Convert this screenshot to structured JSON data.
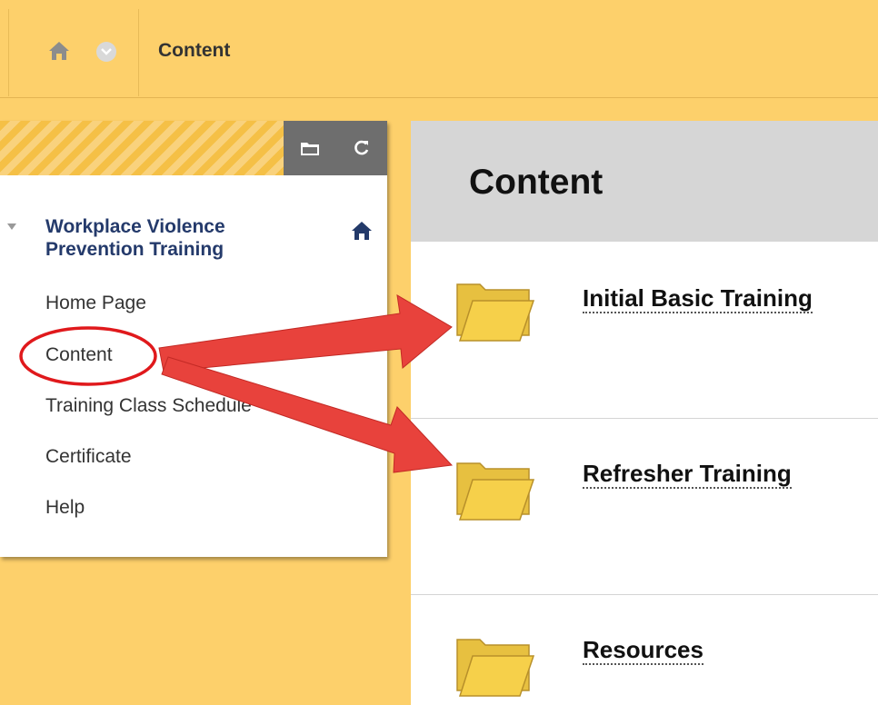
{
  "breadcrumb": {
    "current": "Content"
  },
  "course_menu": {
    "course_title": "Workplace Violence Prevention Training",
    "items": [
      {
        "label": "Home Page"
      },
      {
        "label": "Content"
      },
      {
        "label": "Training Class Schedule"
      },
      {
        "label": "Certificate"
      },
      {
        "label": "Help"
      }
    ]
  },
  "content": {
    "title": "Content",
    "items": [
      {
        "title": "Initial Basic Training",
        "icon": "folder-icon"
      },
      {
        "title": "Refresher Training",
        "icon": "folder-icon"
      },
      {
        "title": "Resources",
        "icon": "folder-icon"
      }
    ]
  },
  "colors": {
    "background": "#fdd06b",
    "annotation_arrow": "#e8423c",
    "annotation_circle": "#e0191c",
    "course_title": "#243a6b"
  }
}
